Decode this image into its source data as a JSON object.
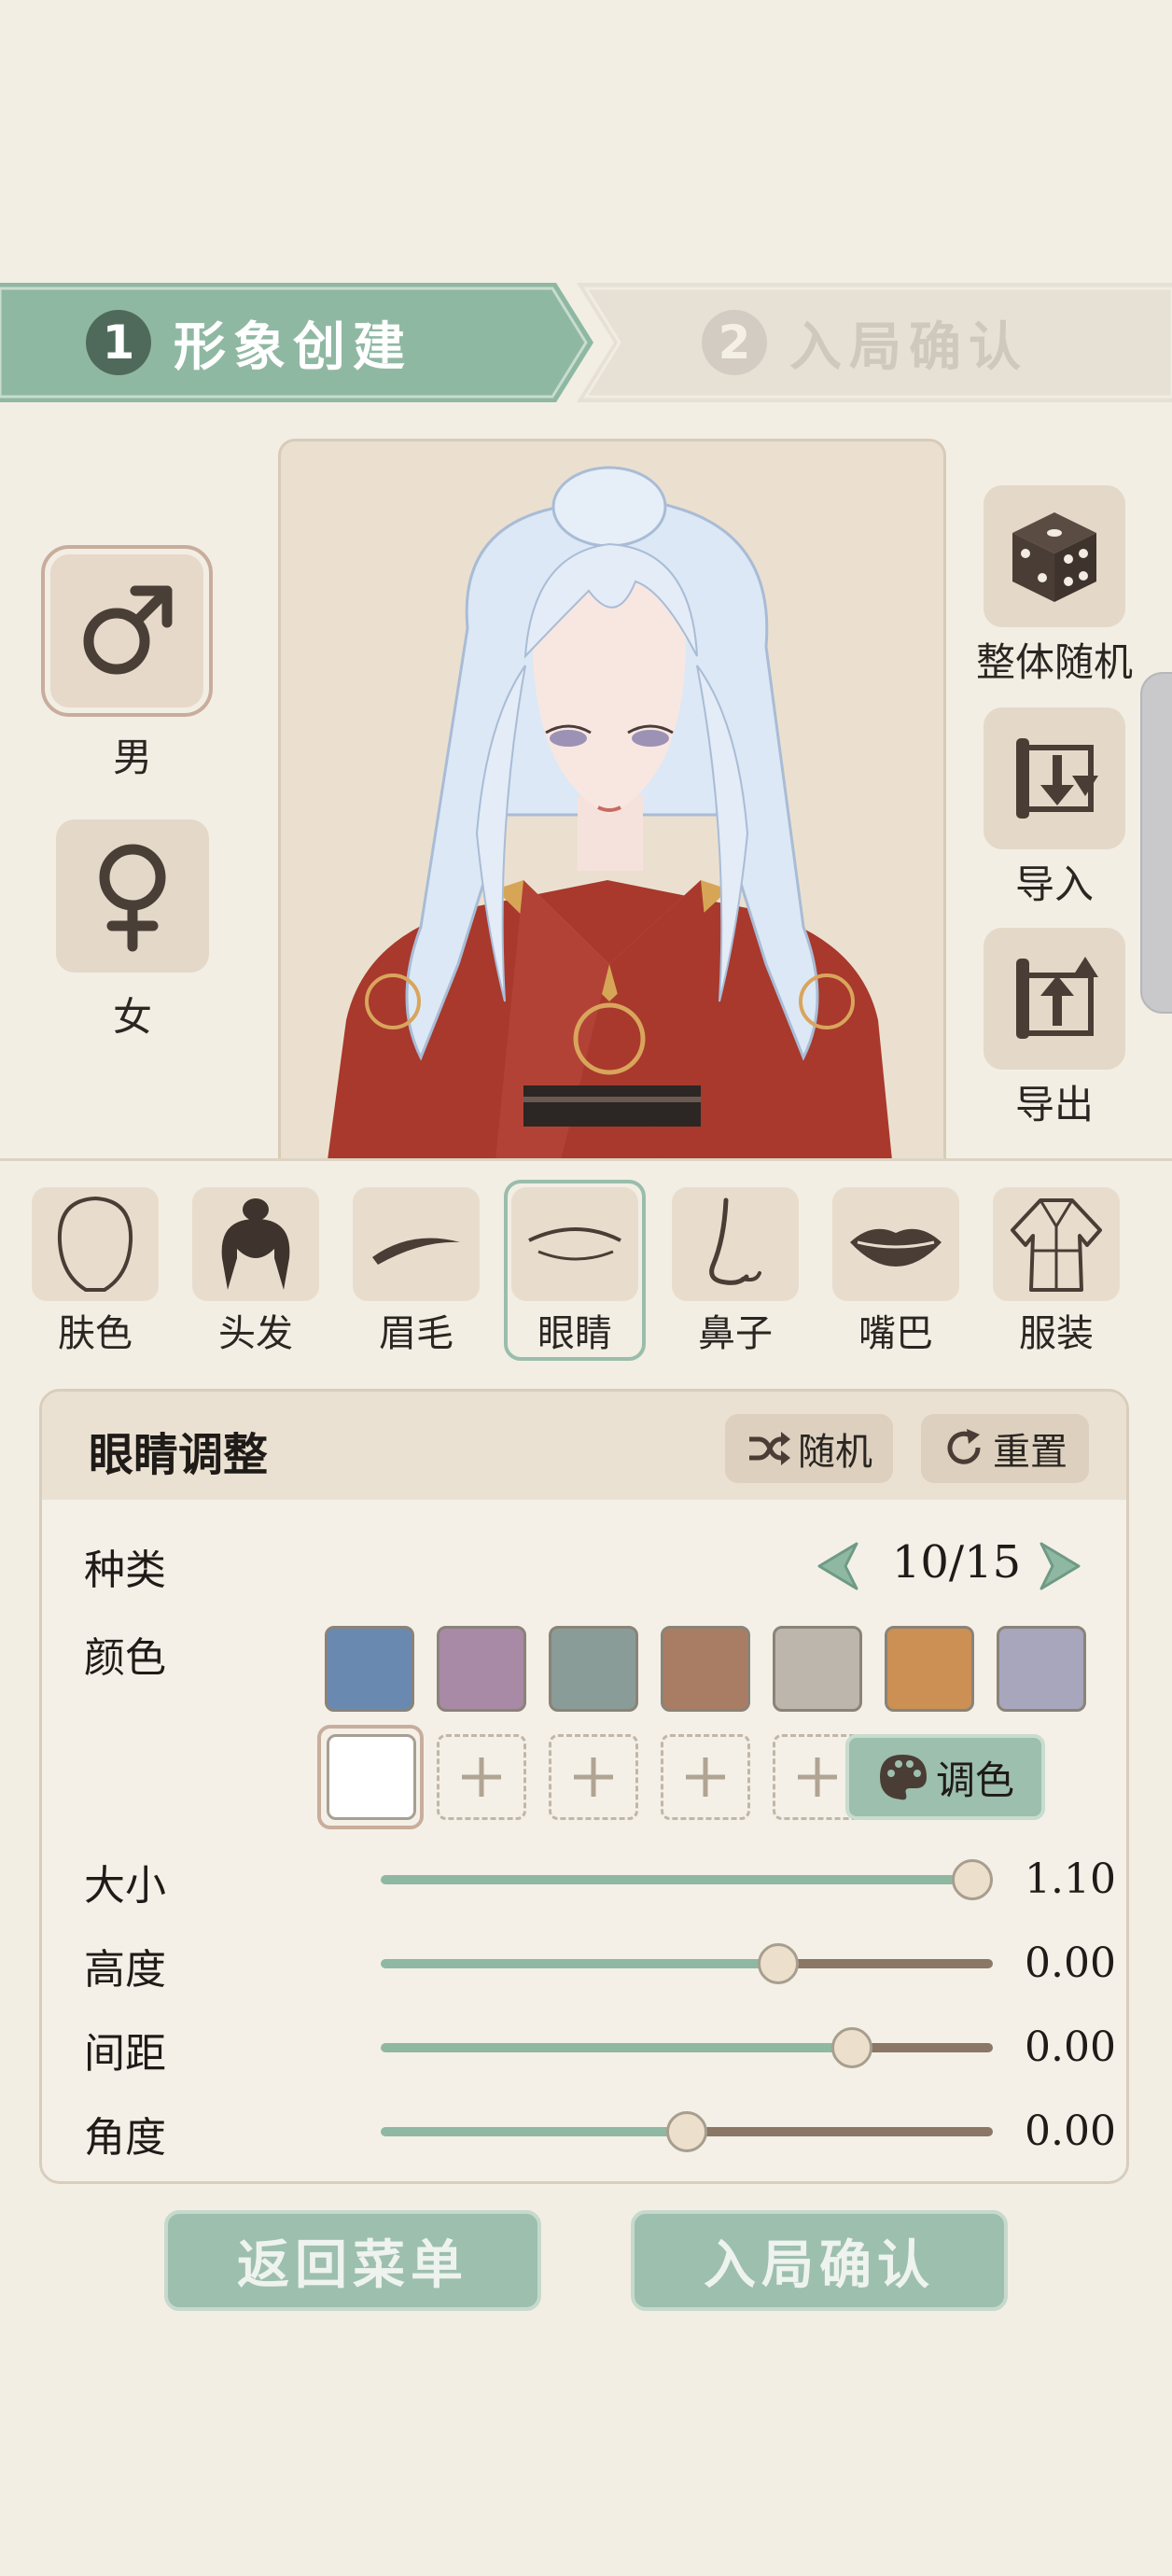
{
  "steps": [
    {
      "num": "1",
      "label": "形象创建",
      "active": true
    },
    {
      "num": "2",
      "label": "入局确认",
      "active": false
    }
  ],
  "gender": {
    "male": {
      "label": "男",
      "icon": "male-symbol-icon",
      "selected": true
    },
    "female": {
      "label": "女",
      "icon": "female-symbol-icon",
      "selected": false
    }
  },
  "tools": {
    "random_all": {
      "label": "整体随机",
      "icon": "dice-icon"
    },
    "import": {
      "label": "导入",
      "icon": "import-scroll-icon"
    },
    "export": {
      "label": "导出",
      "icon": "export-scroll-icon"
    }
  },
  "tabs": [
    {
      "label": "肤色",
      "icon": "face-outline-icon"
    },
    {
      "label": "头发",
      "icon": "hair-bun-icon"
    },
    {
      "label": "眉毛",
      "icon": "eyebrow-icon"
    },
    {
      "label": "眼睛",
      "icon": "eye-icon",
      "active": true
    },
    {
      "label": "鼻子",
      "icon": "nose-icon"
    },
    {
      "label": "嘴巴",
      "icon": "lips-icon"
    },
    {
      "label": "服装",
      "icon": "robe-icon"
    }
  ],
  "panel": {
    "title": "眼睛调整",
    "random_label": "随机",
    "reset_label": "重置",
    "type": {
      "label": "种类",
      "value": "10/15"
    },
    "color": {
      "label": "颜色",
      "swatches": [
        "#6a89b1",
        "#a88aa6",
        "#8a9c98",
        "#a97d64",
        "#bdb6ad",
        "#cc9054",
        "#a7a6bd"
      ],
      "custom": [
        "#ffffff"
      ],
      "palette_label": "调色"
    },
    "sliders": [
      {
        "label": "大小",
        "value": "1.10",
        "fraction": 1.0
      },
      {
        "label": "高度",
        "value": "0.00",
        "fraction": 0.66
      },
      {
        "label": "间距",
        "value": "0.00",
        "fraction": 0.79
      },
      {
        "label": "角度",
        "value": "0.00",
        "fraction": 0.5
      }
    ]
  },
  "footer": {
    "back_label": "返回菜单",
    "confirm_label": "入局确认"
  },
  "colors": {
    "accent_green": "#8fb8a3",
    "bg": "#f2eee4",
    "tile": "#e4d8c8"
  }
}
